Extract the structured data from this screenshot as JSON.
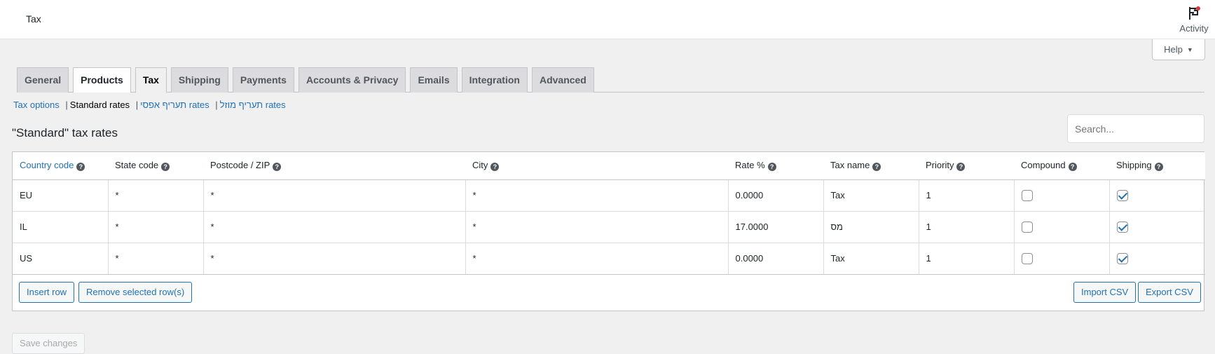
{
  "header": {
    "title": "Tax",
    "activity_label": "Activity"
  },
  "help": {
    "label": "Help"
  },
  "tabs": [
    {
      "label": "General"
    },
    {
      "label": "Products"
    },
    {
      "label": "Tax"
    },
    {
      "label": "Shipping"
    },
    {
      "label": "Payments"
    },
    {
      "label": "Accounts & Privacy"
    },
    {
      "label": "Emails"
    },
    {
      "label": "Integration"
    },
    {
      "label": "Advanced"
    }
  ],
  "sections": {
    "tax_options": "Tax options",
    "standard_rates": "Standard rates",
    "reduced_rates": "תעריף אפסי rates",
    "zero_rates": "תעריף מוזל rates"
  },
  "section_title": "\"Standard\" tax rates",
  "search": {
    "placeholder": "Search..."
  },
  "table": {
    "columns": [
      "Country code",
      "State code",
      "Postcode / ZIP",
      "City",
      "Rate %",
      "Tax name",
      "Priority",
      "Compound",
      "Shipping"
    ],
    "rows": [
      {
        "country": "EU",
        "state": "*",
        "postcode": "*",
        "city": "*",
        "rate": "0.0000",
        "name": "Tax",
        "priority": "1",
        "compound": false,
        "shipping": true
      },
      {
        "country": "IL",
        "state": "*",
        "postcode": "*",
        "city": "*",
        "rate": "17.0000",
        "name": "מס",
        "priority": "1",
        "compound": false,
        "shipping": true
      },
      {
        "country": "US",
        "state": "*",
        "postcode": "*",
        "city": "*",
        "rate": "0.0000",
        "name": "Tax",
        "priority": "1",
        "compound": false,
        "shipping": true
      }
    ]
  },
  "buttons": {
    "insert_row": "Insert row",
    "remove_rows": "Remove selected row(s)",
    "import_csv": "Import CSV",
    "export_csv": "Export CSV",
    "save_changes": "Save changes"
  },
  "colors": {
    "link": "#2271b1",
    "background": "#f0f0f1"
  }
}
